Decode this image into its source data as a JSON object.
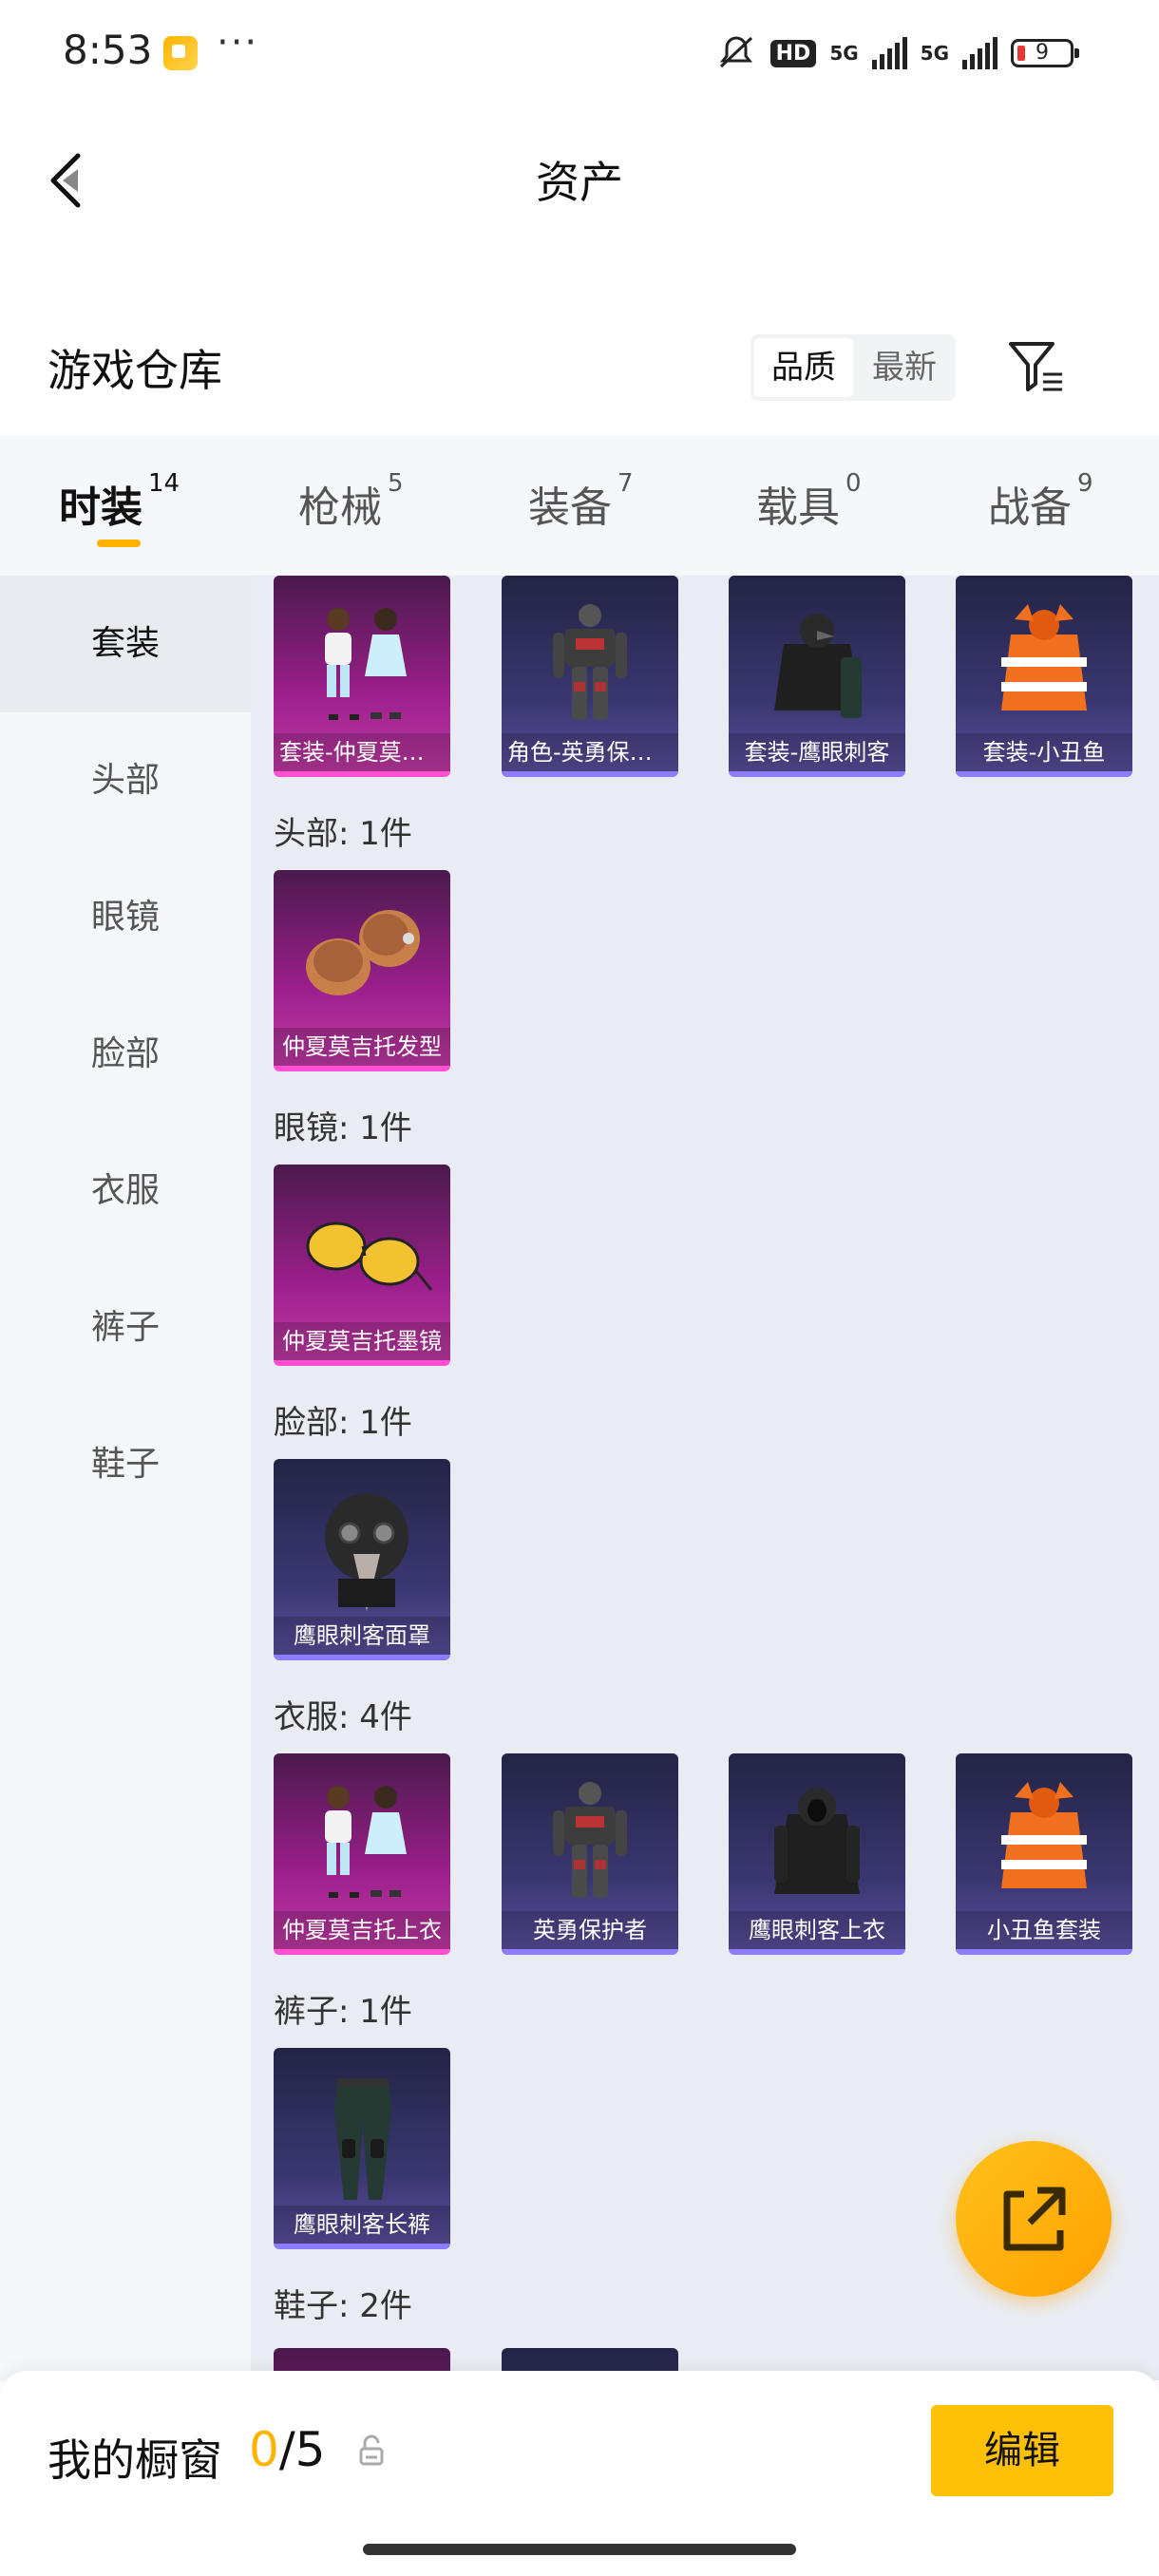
{
  "status_bar": {
    "time": "8:53",
    "dots": "···",
    "hd": "HD",
    "net1": "5G",
    "net2": "5G",
    "battery": "9"
  },
  "header": {
    "title": "资产"
  },
  "section": {
    "title": "游戏仓库",
    "sort_quality": "品质",
    "sort_newest": "最新"
  },
  "tabs": [
    {
      "label": "时装",
      "count": "14",
      "active": true
    },
    {
      "label": "枪械",
      "count": "5"
    },
    {
      "label": "装备",
      "count": "7"
    },
    {
      "label": "载具",
      "count": "0"
    },
    {
      "label": "战备",
      "count": "9"
    }
  ],
  "sidebar": [
    {
      "label": "套装",
      "active": true
    },
    {
      "label": "头部"
    },
    {
      "label": "眼镜"
    },
    {
      "label": "脸部"
    },
    {
      "label": "衣服"
    },
    {
      "label": "裤子"
    },
    {
      "label": "鞋子"
    }
  ],
  "groups": {
    "suits": [
      {
        "label": "套装-仲夏莫吉托",
        "quality": "pink",
        "icon": "outfit-pair"
      },
      {
        "label": "角色-英勇保护者",
        "quality": "purple",
        "icon": "armor-figure"
      },
      {
        "label": "套装-鹰眼刺客",
        "quality": "purple",
        "icon": "dark-outfit"
      },
      {
        "label": "套装-小丑鱼",
        "quality": "purple",
        "icon": "orange-jacket"
      }
    ],
    "head": {
      "title": "头部: 1件",
      "items": [
        {
          "label": "仲夏莫吉托发型",
          "quality": "pink",
          "icon": "hair"
        }
      ]
    },
    "glasses": {
      "title": "眼镜: 1件",
      "items": [
        {
          "label": "仲夏莫吉托墨镜",
          "quality": "pink",
          "icon": "sunglasses"
        }
      ]
    },
    "face": {
      "title": "脸部: 1件",
      "items": [
        {
          "label": "鹰眼刺客面罩",
          "quality": "purple",
          "icon": "plague-mask"
        }
      ]
    },
    "clothes": {
      "title": "衣服: 4件",
      "items": [
        {
          "label": "仲夏莫吉托上衣",
          "quality": "pink",
          "icon": "outfit-pair"
        },
        {
          "label": "英勇保护者",
          "quality": "purple",
          "icon": "armor-figure"
        },
        {
          "label": "鹰眼刺客上衣",
          "quality": "purple",
          "icon": "hoodie"
        },
        {
          "label": "小丑鱼套装",
          "quality": "purple",
          "icon": "orange-jacket"
        }
      ]
    },
    "pants": {
      "title": "裤子: 1件",
      "items": [
        {
          "label": "鹰眼刺客长裤",
          "quality": "purple",
          "icon": "pants"
        }
      ]
    },
    "shoes": {
      "title": "鞋子: 2件"
    }
  },
  "bottom": {
    "label": "我的橱窗",
    "current": "0",
    "total": "/5",
    "edit": "编辑"
  }
}
